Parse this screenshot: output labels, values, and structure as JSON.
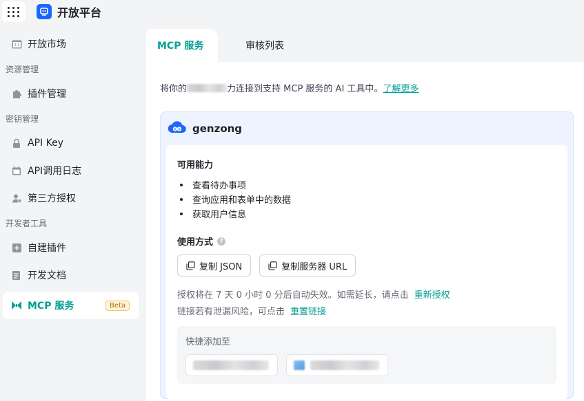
{
  "app": {
    "title": "开放平台"
  },
  "sidebar": {
    "market": "开放市场",
    "groups": {
      "resource": "资源管理",
      "key": "密钥管理",
      "dev": "开发者工具"
    },
    "items": {
      "plugin_manage": "插件管理",
      "api_key": "API Key",
      "api_log": "API调用日志",
      "third_auth": "第三方授权",
      "custom_plugin": "自建插件",
      "dev_docs": "开发文档",
      "mcp": "MCP 服务",
      "mcp_badge": "Beta"
    }
  },
  "tabs": {
    "mcp": "MCP 服务",
    "review": "审核列表"
  },
  "intro": {
    "prefix": "将你的",
    "suffix": "力连接到支持 MCP 服务的 AI 工具中。",
    "link": "了解更多"
  },
  "card": {
    "name": "genzong",
    "capabilities_title": "可用能力",
    "capabilities": [
      "查看待办事项",
      "查询应用和表单中的数据",
      "获取用户信息"
    ],
    "usage_title": "使用方式",
    "help_glyph": "?",
    "copy_json": "复制 JSON",
    "copy_url": "复制服务器 URL",
    "expire_text": "授权将在 7 天 0 小时 0 分后自动失效。如需延长，请点击",
    "reauth_link": "重新授权",
    "leak_text": "链接若有泄漏风险，可点击",
    "reset_link": "重置链接",
    "quick_title": "快捷添加至"
  },
  "colors": {
    "accent": "#009e94",
    "brand": "#1a66ff",
    "card_bg": "#eef4ff"
  }
}
